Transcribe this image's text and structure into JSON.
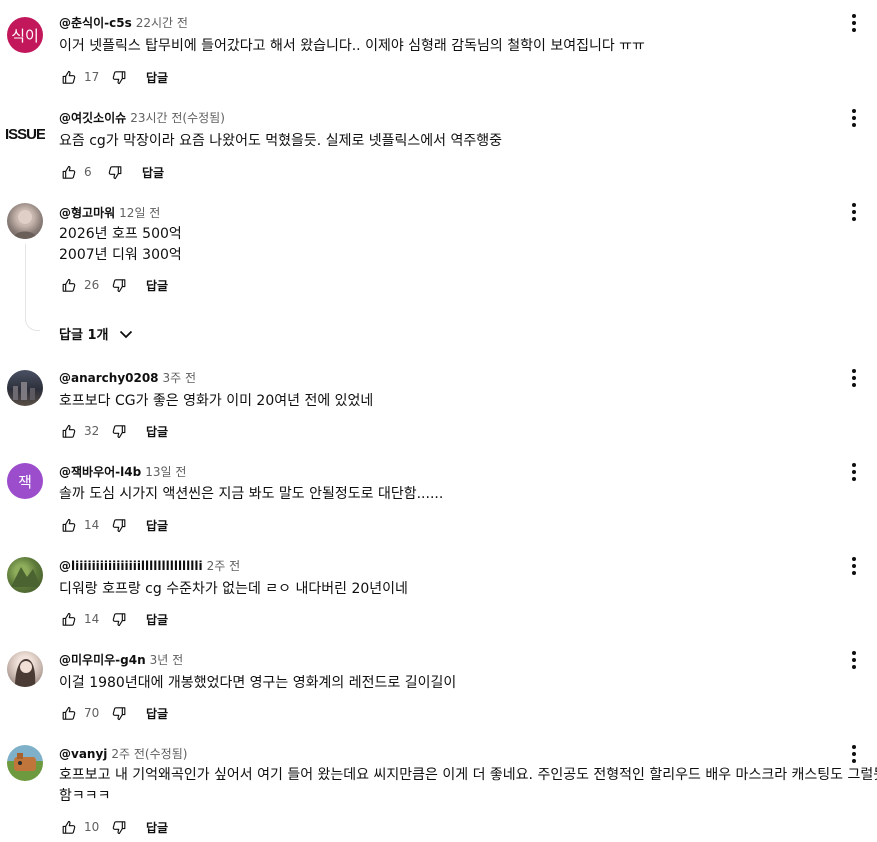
{
  "comments": [
    {
      "author": "@춘식이-c5s",
      "time": "22시간 전",
      "lines": [
        "이거 넷플릭스 탑무비에 들어갔다고 해서 왔습니다.. 이제야 심형래 감독님의 철학이 보여집니다 ㅠㅠ"
      ],
      "likes": "17",
      "reply": "답글",
      "avatar_type": "letter",
      "avatar_letter": "식이",
      "avatar_color": "#c2185b"
    },
    {
      "author": "@여깃소이슈",
      "time": "23시간 전(수정됨)",
      "lines": [
        "요즘 cg가 막장이라 요즘 나왔어도 먹혔을듯. 실제로 넷플릭스에서 역주행중"
      ],
      "likes": "6",
      "reply": "답글",
      "avatar_type": "logo",
      "avatar_letter": "ISSUE"
    },
    {
      "author": "@형고마워",
      "time": "12일 전",
      "lines": [
        "2026년 호프 500억",
        "2007년 디워 300억"
      ],
      "likes": "26",
      "reply": "답글",
      "avatar_type": "photo",
      "avatar_color": "#9b8f8a",
      "replies_label": "답글 1개"
    },
    {
      "author": "@anarchy0208",
      "time": "3주 전",
      "lines": [
        "호프보다 CG가 좋은 영화가 이미 20여년 전에 있었네"
      ],
      "likes": "32",
      "reply": "답글",
      "avatar_type": "photo",
      "avatar_color": "#3a3d4a"
    },
    {
      "author": "@잭바우어-l4b",
      "time": "13일 전",
      "lines": [
        "솔까 도심 시가지 액션씬은 지금 봐도 말도 안될정도로 대단함......"
      ],
      "likes": "14",
      "reply": "답글",
      "avatar_type": "letter",
      "avatar_letter": "잭",
      "avatar_color": "#9c4dcc"
    },
    {
      "author": "@liiiiiiiiiiiiiiiilllllllllllllli",
      "time": "2주 전",
      "lines": [
        "디워랑 호프랑 cg 수준차가 없는데 ㄹㅇ 내다버린 20년이네"
      ],
      "likes": "14",
      "reply": "답글",
      "avatar_type": "photo",
      "avatar_color": "#5d7a3a"
    },
    {
      "author": "@미우미우-g4n",
      "time": "3년 전",
      "lines": [
        "이걸 1980년대에 개봉했었다면 영구는 영화계의 레전드로 길이길이"
      ],
      "likes": "70",
      "reply": "답글",
      "avatar_type": "photo",
      "avatar_color": "#c9b8b0"
    },
    {
      "author": "@vanyj",
      "time": "2주 전(수정됨)",
      "lines": [
        "호프보고 내 기억왜곡인가 싶어서 여기 들어 왔는데요 씨지만큼은 이게 더 좋네요. 주인공도 전형적인 할리우드 배우 마스크라 캐스팅도 그럴듯",
        "함ㅋㅋㅋ"
      ],
      "likes": "10",
      "reply": "답글",
      "avatar_type": "photo",
      "avatar_color": "#c0763a"
    }
  ],
  "icons": {
    "like": "thumb-up-icon",
    "dislike": "thumb-down-icon",
    "more": "kebab-menu-icon",
    "expand": "chevron-down-icon"
  }
}
